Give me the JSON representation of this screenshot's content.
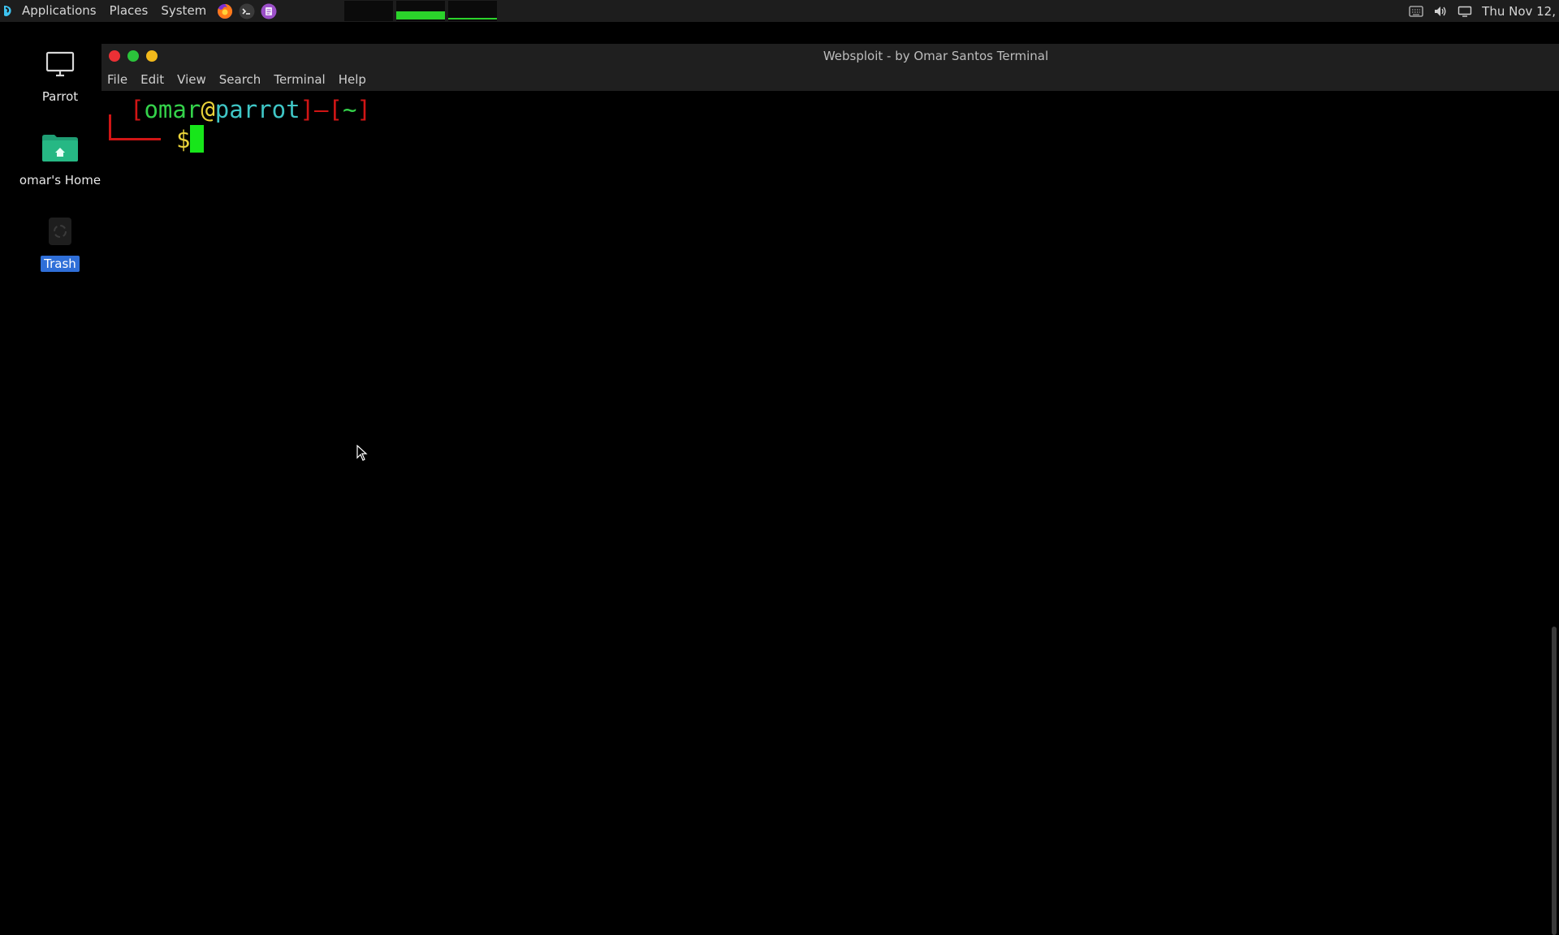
{
  "top_panel": {
    "logo_icon": "parrot-logo-icon",
    "menus": [
      "Applications",
      "Places",
      "System"
    ],
    "launchers": [
      "firefox-icon",
      "terminal-icon",
      "text-editor-icon"
    ],
    "workspaces": [
      {
        "name": "workspace-1",
        "active": false
      },
      {
        "name": "workspace-2",
        "active": true
      },
      {
        "name": "workspace-3",
        "active": false
      }
    ],
    "tray_icons": [
      "keyboard-icon",
      "volume-icon",
      "display-icon"
    ],
    "clock": "Thu Nov 12,"
  },
  "desktop": {
    "icons": [
      {
        "label": "Parrot",
        "icon": "computer-icon",
        "selected": false
      },
      {
        "label": "omar's Home",
        "icon": "home-folder-icon",
        "selected": false
      },
      {
        "label": "Trash",
        "icon": "trash-icon",
        "selected": true
      }
    ]
  },
  "terminal": {
    "title": "Websploit - by Omar Santos Terminal",
    "menus": [
      "File",
      "Edit",
      "View",
      "Search",
      "Terminal",
      "Help"
    ],
    "prompt": {
      "open_bracket": "[",
      "user": "omar",
      "at": "@",
      "host": "parrot",
      "close_bracket": "]",
      "dash": "—",
      "cwd_open": "[",
      "cwd": "~",
      "cwd_close": "]",
      "symbol": "$"
    }
  },
  "colors": {
    "panel_bg": "#1d1d1d",
    "accent_green": "#2bd32b",
    "prompt_red": "#d01515",
    "prompt_green": "#34d24a",
    "prompt_yellow": "#e9d23a",
    "prompt_cyan": "#3fc6c6",
    "selection_blue": "#2f6fd8"
  }
}
